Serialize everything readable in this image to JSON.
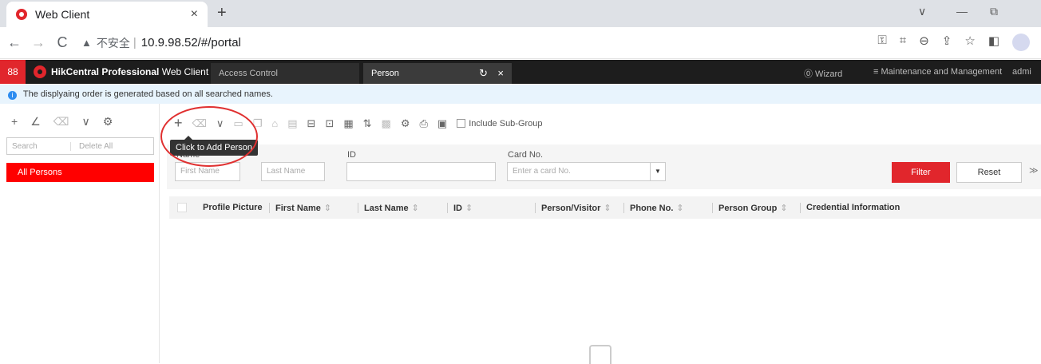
{
  "browser": {
    "tab_title": "Web Client",
    "tab_close": "×",
    "new_tab": "+",
    "url_insecure": "不安全",
    "url_sep": "|",
    "url": "10.9.98.52/#/portal",
    "back": "←",
    "forward": "→",
    "reload": "C",
    "warn": "▲",
    "minimize": "—",
    "restore": "⧉",
    "chevron": "∨"
  },
  "app": {
    "apps_icon": "88",
    "brand_bold": "HikCentral Professional",
    "brand_rest": " Web Client",
    "tabs": [
      {
        "label": "Access Control"
      },
      {
        "label": "Person",
        "refresh": "↻",
        "close": "×"
      }
    ],
    "wizard": "⓪ Wizard",
    "maintenance": "≡  Maintenance and Management",
    "admin": "admi"
  },
  "info": {
    "icon": "i",
    "message": "The displyaing order is generated based on all searched names."
  },
  "left_panel": {
    "tools": [
      "+",
      "∠",
      "⌫",
      "∨",
      "⚙"
    ],
    "search_placeholder": "Search",
    "delete_all": "Delete All",
    "all_persons": "All Persons"
  },
  "toolbar": {
    "add": "+",
    "delete": "🗑",
    "dropdown": "∨",
    "include_sub_group": "Include Sub-Group"
  },
  "tooltip": "Click to Add Person",
  "filter": {
    "name_label": "Name",
    "first_name_placeholder": "First Name",
    "last_name_placeholder": "Last Name",
    "id_label": "ID",
    "card_label": "Card No.",
    "card_placeholder": "Enter a card No.",
    "card_dropdown": "▼",
    "filter_button": "Filter",
    "reset_button": "Reset",
    "expand": "≫"
  },
  "table": {
    "sort_glyph": "⇕",
    "columns": [
      "Profile Picture",
      "First Name",
      "Last Name",
      "ID",
      "Person/Visitor",
      "Phone No.",
      "Person Group",
      "Credential Information"
    ]
  }
}
